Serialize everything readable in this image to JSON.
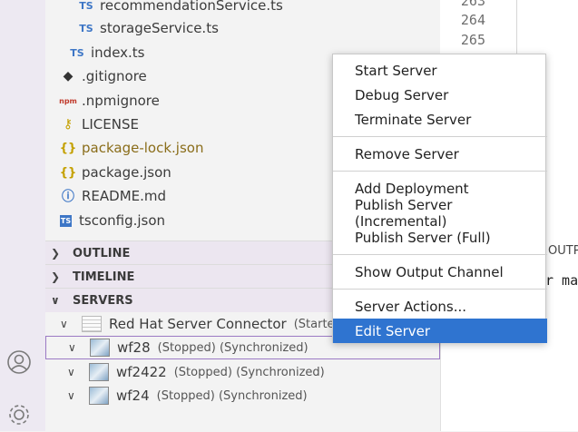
{
  "editor": {
    "line_numbers": [
      "263",
      "264",
      "265"
    ]
  },
  "explorer": {
    "files": [
      {
        "name": "recommendationService.ts",
        "icon": "ts-icon",
        "indent": 2
      },
      {
        "name": "storageService.ts",
        "icon": "ts-icon",
        "indent": 2
      },
      {
        "name": "index.ts",
        "icon": "ts-icon",
        "indent": 1
      },
      {
        "name": ".gitignore",
        "icon": "git-icon",
        "indent": 0
      },
      {
        "name": ".npmignore",
        "icon": "npm-icon",
        "indent": 0
      },
      {
        "name": "LICENSE",
        "icon": "license-icon",
        "indent": 0
      },
      {
        "name": "package-lock.json",
        "icon": "json-icon",
        "indent": 0,
        "modified": true
      },
      {
        "name": "package.json",
        "icon": "json-icon",
        "indent": 0
      },
      {
        "name": "README.md",
        "icon": "info-icon",
        "indent": 0
      },
      {
        "name": "tsconfig.json",
        "icon": "ts-config-icon",
        "indent": 0
      }
    ],
    "icon_glyphs": {
      "ts": "TS",
      "json": "{}",
      "git": "◆",
      "npm": "npm",
      "license": "🔑",
      "info": "ⓘ",
      "tsbox": "TS"
    }
  },
  "sections": {
    "outline": "OUTLINE",
    "timeline": "TIMELINE",
    "servers": "SERVERS"
  },
  "servers": {
    "connector": {
      "name": "Red Hat Server Connector",
      "status": "(Started)"
    },
    "items": [
      {
        "name": "wf28",
        "status": "(Stopped) (Synchronized)"
      },
      {
        "name": "wf2422",
        "status": "(Stopped) (Synchronized)"
      },
      {
        "name": "wf24",
        "status": "(Stopped) (Synchronized)"
      }
    ]
  },
  "panel": {
    "tab_label": "OUTP",
    "text": "r ma"
  },
  "context_menu": {
    "groups": [
      [
        "Start Server",
        "Debug Server",
        "Terminate Server"
      ],
      [
        "Remove Server"
      ],
      [
        "Add Deployment",
        "Publish Server (Incremental)",
        "Publish Server (Full)"
      ],
      [
        "Show Output Channel"
      ],
      [
        "Server Actions...",
        "Edit Server"
      ]
    ],
    "highlighted": "Edit Server"
  },
  "colors": {
    "accent": "#2f74d0",
    "focus_outline": "#9b7ac4",
    "activity_bar": "#ede9f2"
  }
}
